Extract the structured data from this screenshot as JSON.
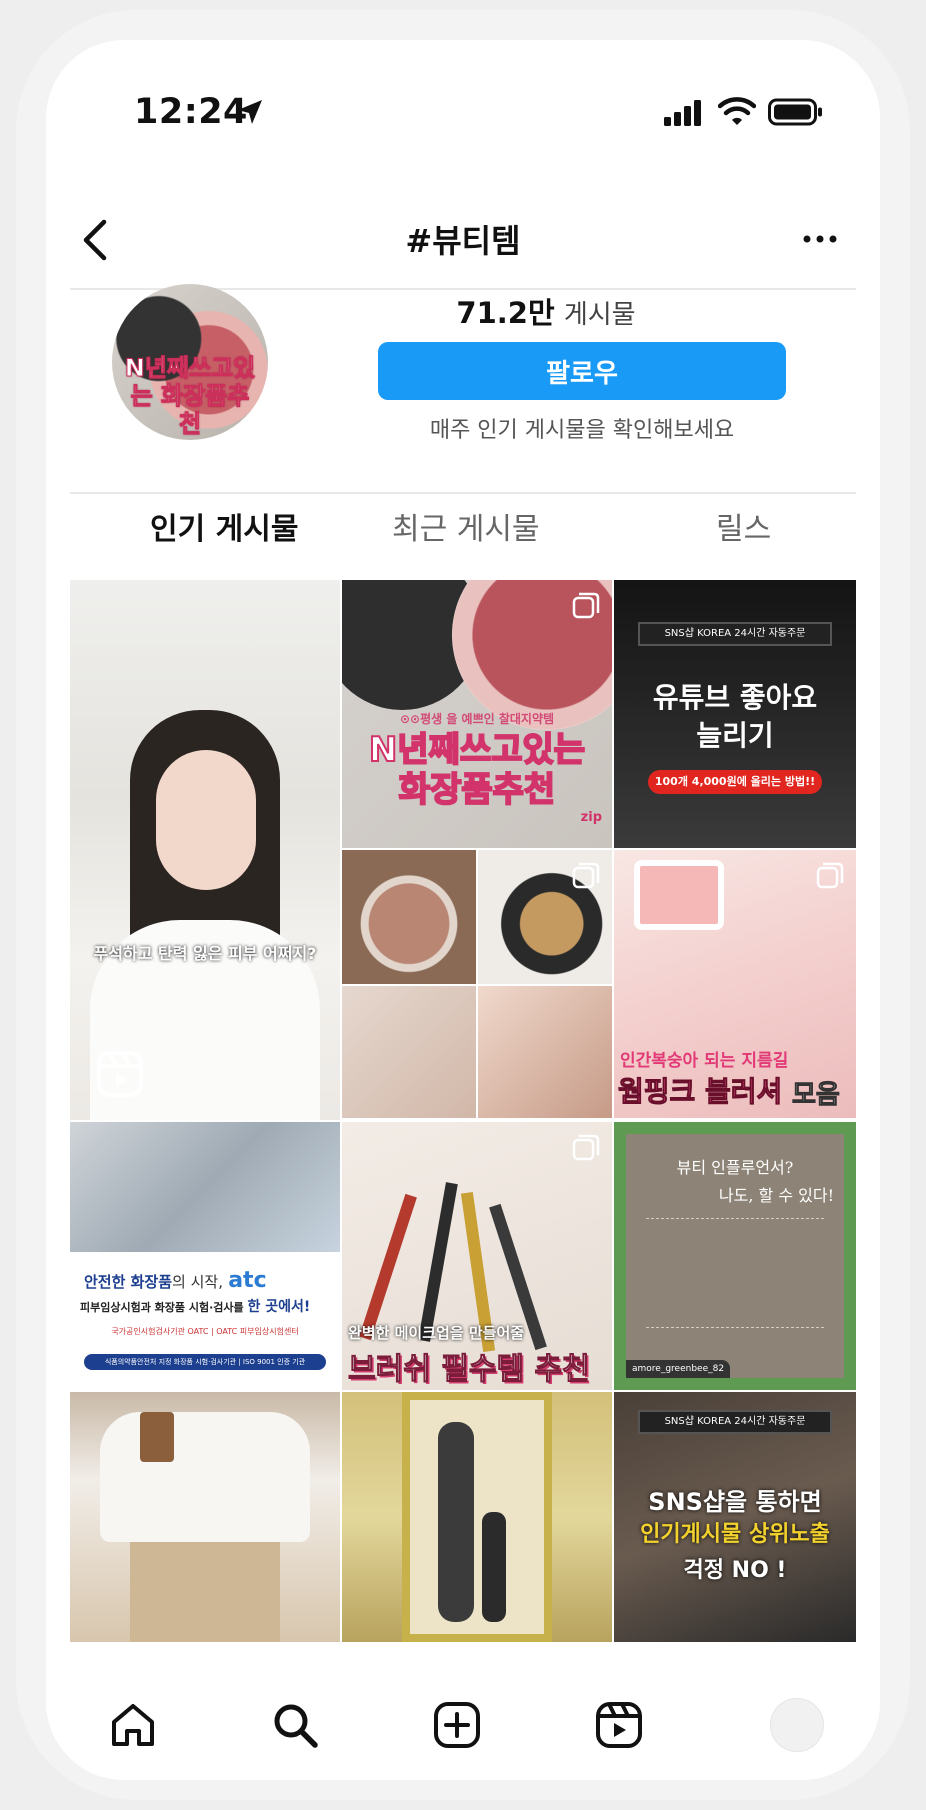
{
  "status": {
    "time": "12:24",
    "icons": [
      "location-arrow-icon",
      "cellular-signal-icon",
      "wifi-icon",
      "battery-icon"
    ]
  },
  "header": {
    "title": "#뷰티템",
    "back_icon": "chevron-left-icon",
    "more_icon": "ellipsis-icon"
  },
  "profile": {
    "avatar_text": "N년째쓰고있는 화장품추천",
    "post_count": "71.2만",
    "post_label": "게시물",
    "follow_label": "팔로우",
    "subtitle": "매주 인기 게시물을 확인해보세요"
  },
  "tabs": [
    {
      "label": "인기 게시물",
      "active": true
    },
    {
      "label": "최근 게시물",
      "active": false
    },
    {
      "label": "릴스",
      "active": false
    }
  ],
  "posts": [
    {
      "caption": "푸석하고 탄력 잃은 피부 어쩌지?",
      "type": "reel"
    },
    {
      "caption_top": "⊙⊙평생 을 예쁘인 찰대지약템",
      "caption_main": "N년째쓰고있는 화장품추천",
      "caption_tail": "zip",
      "type": "carousel"
    },
    {
      "badge": "SNS샵 KOREA 24시간 자동주문",
      "headline_1": "유튜브 좋아요",
      "headline_2": "늘리기",
      "pill": "100개 4,000원에 올리는 방법!!"
    },
    {
      "type": "carousel"
    },
    {
      "caption_1": "인간복숭아 되는 지름길",
      "caption_2": "웜핑크 블러셔",
      "caption_3": "모음",
      "type": "carousel"
    },
    {
      "caption_1a": "안전한 화장품",
      "caption_1b": "의 시작,",
      "logo": "atc",
      "caption_2a": "피부임상시험과 화장품 시험·검사를",
      "caption_2b": "한 곳에서!",
      "small_1": "국가공인시험검사기관 OATC | OATC 피부임상시험센터",
      "small_2": "식품의약품안전처 지정 화장품 시험·검사기관 | ISO 9001 인증 기관"
    },
    {
      "caption_1": "완벽한 메이크업을 만들어줄",
      "caption_2": "브러쉬 필수템 추천",
      "type": "carousel"
    },
    {
      "handwriting_1": "뷰티 인플루언서?",
      "handwriting_2": "나도, 할 수 있다!",
      "user": "amore_greenbee_82"
    },
    {},
    {},
    {
      "badge": "SNS샵 KOREA 24시간 자동주문",
      "headline_1": "SNS샵을 통하면",
      "headline_2": "인기게시물 상위노출",
      "headline_3": "걱정 NO !"
    }
  ],
  "nav": [
    "home-icon",
    "search-icon",
    "add-post-icon",
    "reels-icon",
    "profile-avatar"
  ],
  "colors": {
    "accent": "#1a9af7",
    "text": "#111111",
    "muted": "#666666",
    "divider": "#e8e8e8"
  }
}
